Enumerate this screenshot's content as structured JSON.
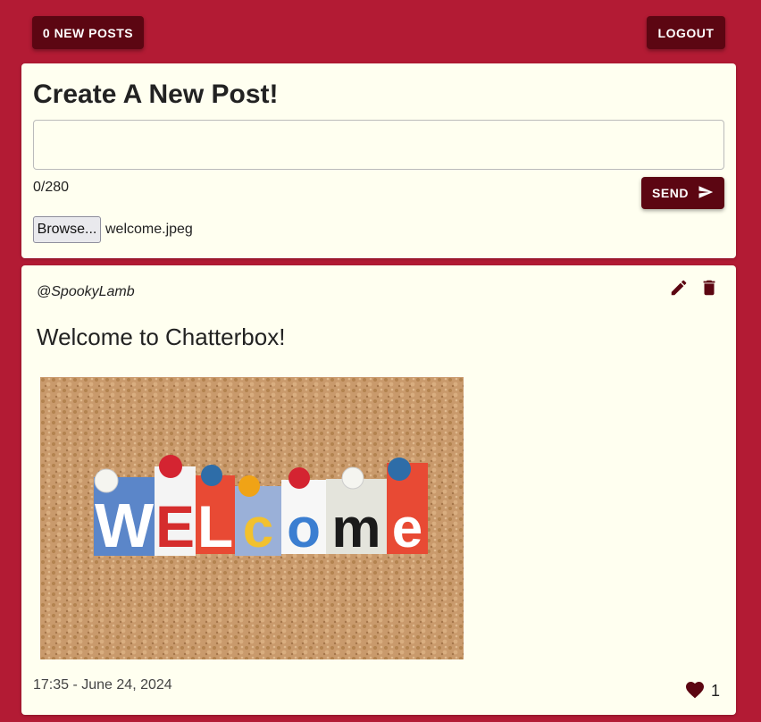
{
  "header": {
    "new_posts_label": "0 NEW POSTS",
    "logout_label": "LOGOUT"
  },
  "create_post": {
    "title": "Create A New Post!",
    "input_value": "",
    "char_count": "0/280",
    "send_label": "SEND",
    "browse_label": "Browse...",
    "file_name": "welcome.jpeg"
  },
  "post": {
    "username": "@SpookyLamb",
    "text": "Welcome to Chatterbox!",
    "timestamp": "17:35 - June 24, 2024",
    "like_count": "1",
    "image_letters": "WELCOME"
  },
  "icons": {
    "send": "send-icon",
    "edit": "pencil-icon",
    "delete": "trash-icon",
    "like": "heart-icon"
  },
  "colors": {
    "background": "#b31b34",
    "card": "#fffff0",
    "button": "#5c0612",
    "icon": "#5c0612"
  }
}
